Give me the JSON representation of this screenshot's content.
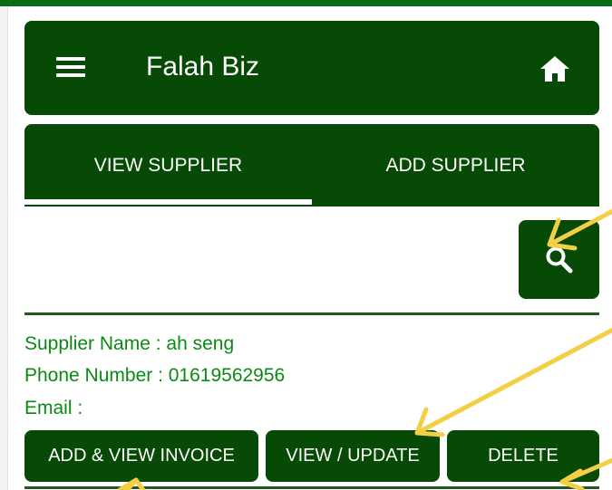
{
  "colors": {
    "primary": "#064a06",
    "accent_text": "#0a8a14",
    "on_primary": "#ffffff",
    "annotation": "#f2cf45"
  },
  "app_bar": {
    "title": "Falah Biz",
    "menu_icon": "menu-icon",
    "home_icon": "home-icon"
  },
  "tabs": [
    {
      "label": "VIEW SUPPLIER",
      "selected": true
    },
    {
      "label": "ADD SUPPLIER",
      "selected": false
    }
  ],
  "search": {
    "icon": "search-icon"
  },
  "supplier": {
    "name_line": "Supplier Name : ah seng",
    "phone_line": "Phone Number : 01619562956",
    "email_line": "Email :"
  },
  "actions": {
    "invoice_label": "ADD & VIEW INVOICE",
    "update_label": "VIEW / UPDATE",
    "delete_label": "DELETE"
  },
  "annotations": {
    "icon": "arrow-icon",
    "count": 5
  }
}
